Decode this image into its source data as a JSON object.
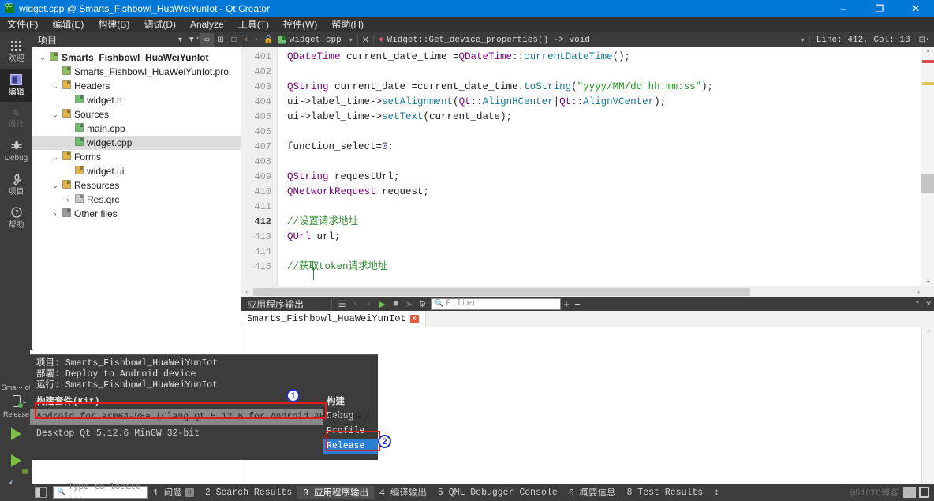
{
  "window": {
    "title": "widget.cpp @ Smarts_Fishbowl_HuaWeiYunIot - Qt Creator",
    "app_icon": "qt-creator-icon",
    "minimize": "–",
    "maximize": "❐",
    "close": "✕"
  },
  "menubar": {
    "items": [
      {
        "label": "文件(F)"
      },
      {
        "label": "编辑(E)"
      },
      {
        "label": "构建(B)"
      },
      {
        "label": "调试(D)"
      },
      {
        "label": "Analyze"
      },
      {
        "label": "工具(T)"
      },
      {
        "label": "控件(W)"
      },
      {
        "label": "帮助(H)"
      }
    ]
  },
  "modebar": {
    "modes": [
      {
        "label": "欢迎",
        "glyph": "∷",
        "state": "normal"
      },
      {
        "label": "编辑",
        "glyph": "▣",
        "state": "active"
      },
      {
        "label": "设计",
        "glyph": "✎",
        "state": "disabled"
      },
      {
        "label": "Debug",
        "glyph": "✶",
        "state": "normal"
      },
      {
        "label": "项目",
        "glyph": "⚒",
        "state": "normal"
      },
      {
        "label": "帮助",
        "glyph": "?",
        "state": "normal"
      }
    ],
    "kit_selector": {
      "project_short": "Sma⋯Iot",
      "build_config": "Release",
      "target_icon": "android-device-icon"
    },
    "run_button": "run-icon",
    "debug_button": "debug-icon",
    "build_button": "build-hammer-icon"
  },
  "project_panel": {
    "header": {
      "title": "项目",
      "dropdown_icon": "▾",
      "filter_icon": "filter-icon",
      "link_icon": "sync-with-editor-icon",
      "expand_icon": "expand-all-icon",
      "collapse_icon": "collapse-icon"
    },
    "tree": [
      {
        "indent": 0,
        "twisty": "⌄",
        "icon": "project-icon",
        "icon_color": "#8fbf5c",
        "label": "Smarts_Fishbowl_HuaWeiYunIot",
        "bold": true,
        "selected": false
      },
      {
        "indent": 1,
        "twisty": "",
        "icon": "pro-file-icon",
        "icon_color": "#8fbf5c",
        "label": "Smarts_Fishbowl_HuaWeiYunIot.pro",
        "bold": false,
        "selected": false
      },
      {
        "indent": 1,
        "twisty": "⌄",
        "icon": "headers-folder-icon",
        "icon_color": "#e0b24a",
        "label": "Headers",
        "bold": false,
        "selected": false
      },
      {
        "indent": 2,
        "twisty": "",
        "icon": "cpp-file-icon",
        "icon_color": "#6fbf6f",
        "label": "widget.h",
        "bold": false,
        "selected": false
      },
      {
        "indent": 1,
        "twisty": "⌄",
        "icon": "sources-folder-icon",
        "icon_color": "#e0b24a",
        "label": "Sources",
        "bold": false,
        "selected": false
      },
      {
        "indent": 2,
        "twisty": "",
        "icon": "cpp-file-icon",
        "icon_color": "#6fbf6f",
        "label": "main.cpp",
        "bold": false,
        "selected": false
      },
      {
        "indent": 2,
        "twisty": "",
        "icon": "cpp-file-icon",
        "icon_color": "#6fbf6f",
        "label": "widget.cpp",
        "bold": false,
        "selected": true
      },
      {
        "indent": 1,
        "twisty": "⌄",
        "icon": "forms-folder-icon",
        "icon_color": "#e0b24a",
        "label": "Forms",
        "bold": false,
        "selected": false
      },
      {
        "indent": 2,
        "twisty": "",
        "icon": "ui-file-icon",
        "icon_color": "#e0b24a",
        "label": "widget.ui",
        "bold": false,
        "selected": false
      },
      {
        "indent": 1,
        "twisty": "⌄",
        "icon": "resources-folder-icon",
        "icon_color": "#e0b24a",
        "label": "Resources",
        "bold": false,
        "selected": false
      },
      {
        "indent": 2,
        "twisty": "›",
        "icon": "qrc-file-icon",
        "icon_color": "#c8c8c8",
        "label": "Res.qrc",
        "bold": false,
        "selected": false
      },
      {
        "indent": 1,
        "twisty": "›",
        "icon": "other-files-icon",
        "icon_color": "#9a9a9a",
        "label": "Other files",
        "bold": false,
        "selected": false
      }
    ]
  },
  "editor": {
    "toolbar": {
      "back_icon": "‹",
      "forward_icon": "›",
      "lock_icon": "🔓",
      "file_name": "widget.cpp",
      "file_dropdown": "▾",
      "close_icon": "✕",
      "symbol_marker": "♦",
      "symbol_name": "Widget::Get_device_properties() -> void",
      "symbol_dropdown": "▾",
      "cursor_position": "Line: 412, Col: 13",
      "split_icon": "split-editor-icon"
    },
    "first_line_number": 401,
    "current_line": 412,
    "lines": [
      {
        "no": 401,
        "tokens": [
          {
            "t": "QDateTime",
            "c": "tk-type"
          },
          {
            "t": " current_date_time =",
            "c": "tk-plain"
          },
          {
            "t": "QDateTime",
            "c": "tk-type"
          },
          {
            "t": "::",
            "c": "tk-plain"
          },
          {
            "t": "currentDateTime",
            "c": "tk-fn"
          },
          {
            "t": "();",
            "c": "tk-plain"
          }
        ]
      },
      {
        "no": 402,
        "tokens": []
      },
      {
        "no": 403,
        "tokens": [
          {
            "t": "QString",
            "c": "tk-type"
          },
          {
            "t": " current_date =current_date_time.",
            "c": "tk-plain"
          },
          {
            "t": "toString",
            "c": "tk-fn"
          },
          {
            "t": "(",
            "c": "tk-plain"
          },
          {
            "t": "\"yyyy/MM/dd hh:mm:ss\"",
            "c": "tk-str"
          },
          {
            "t": ");",
            "c": "tk-plain"
          }
        ]
      },
      {
        "no": 404,
        "tokens": [
          {
            "t": "ui->label_time->",
            "c": "tk-plain"
          },
          {
            "t": "setAlignment",
            "c": "tk-fn"
          },
          {
            "t": "(",
            "c": "tk-plain"
          },
          {
            "t": "Qt",
            "c": "tk-type"
          },
          {
            "t": "::",
            "c": "tk-plain"
          },
          {
            "t": "AlignHCenter",
            "c": "tk-fn"
          },
          {
            "t": "|",
            "c": "tk-plain"
          },
          {
            "t": "Qt",
            "c": "tk-type"
          },
          {
            "t": "::",
            "c": "tk-plain"
          },
          {
            "t": "AlignVCenter",
            "c": "tk-fn"
          },
          {
            "t": ");",
            "c": "tk-plain"
          }
        ]
      },
      {
        "no": 405,
        "tokens": [
          {
            "t": "ui->label_time->",
            "c": "tk-plain"
          },
          {
            "t": "setText",
            "c": "tk-fn"
          },
          {
            "t": "(current_date);",
            "c": "tk-plain"
          }
        ]
      },
      {
        "no": 406,
        "tokens": []
      },
      {
        "no": 407,
        "tokens": [
          {
            "t": "function_select=",
            "c": "tk-plain"
          },
          {
            "t": "0",
            "c": "tk-num"
          },
          {
            "t": ";",
            "c": "tk-plain"
          }
        ]
      },
      {
        "no": 408,
        "tokens": []
      },
      {
        "no": 409,
        "tokens": [
          {
            "t": "QString",
            "c": "tk-type"
          },
          {
            "t": " requestUrl;",
            "c": "tk-plain"
          }
        ]
      },
      {
        "no": 410,
        "tokens": [
          {
            "t": "QNetworkRequest",
            "c": "tk-type"
          },
          {
            "t": " request;",
            "c": "tk-plain"
          }
        ]
      },
      {
        "no": 411,
        "tokens": []
      },
      {
        "no": 412,
        "tokens": [
          {
            "t": "//设置请求地址",
            "c": "tk-cmt"
          }
        ]
      },
      {
        "no": 413,
        "tokens": [
          {
            "t": "QUrl",
            "c": "tk-type"
          },
          {
            "t": " url;",
            "c": "tk-plain"
          }
        ]
      },
      {
        "no": 414,
        "tokens": []
      },
      {
        "no": 415,
        "tokens": [
          {
            "t": "//获取token请求地址",
            "c": "tk-cmt"
          }
        ]
      }
    ],
    "scroll_left_arrow": "‹",
    "scroll_right_arrow": "›",
    "marks_up": "⌃",
    "marks_down": "⌄"
  },
  "output_pane": {
    "title": "应用程序输出",
    "buttons": [
      {
        "name": "word-wrap-icon",
        "glyph": "☰",
        "state": "normal"
      },
      {
        "name": "prev-item-icon",
        "glyph": "‹",
        "state": "disabled"
      },
      {
        "name": "next-item-icon",
        "glyph": "›",
        "state": "disabled"
      },
      {
        "name": "run-icon",
        "glyph": "▶",
        "state": "play"
      },
      {
        "name": "stop-icon",
        "glyph": "■",
        "state": "stop"
      },
      {
        "name": "attach-icon",
        "glyph": "➤",
        "state": "disabled"
      },
      {
        "name": "settings-gear-icon",
        "glyph": "⚙",
        "state": "normal"
      }
    ],
    "filter_placeholder": "Filter",
    "zoom_in": "+",
    "zoom_out": "−",
    "maximize_icon": "⌃",
    "close_icon": "✕",
    "tabs": [
      {
        "label": "Smarts_Fishbowl_HuaWeiYunIot",
        "close": "✕"
      }
    ],
    "scroll_up": "⌃",
    "scroll_down": "⌄"
  },
  "kit_popup": {
    "meta": [
      {
        "key": "项目:",
        "value": "Smarts_Fishbowl_HuaWeiYunIot"
      },
      {
        "key": "部署:",
        "value": "Deploy to Android device"
      },
      {
        "key": "运行:",
        "value": "Smarts_Fishbowl_HuaWeiYunIot"
      }
    ],
    "kit_column_header": "构建套件(Kit)",
    "build_column_header": "构建",
    "kits": [
      {
        "label": "Android for arm64-v8a (Clang Qt 5.12.6 for Android ARM64-v8a)",
        "selected": true
      },
      {
        "label": "Desktop Qt 5.12.6 MinGW 32-bit",
        "selected": false
      }
    ],
    "builds": [
      {
        "label": "Debug",
        "selected": false
      },
      {
        "label": "Profile",
        "selected": false
      },
      {
        "label": "Release",
        "selected": true
      }
    ],
    "annotations": [
      {
        "number": "1",
        "target": "kit-row-android"
      },
      {
        "number": "2",
        "target": "build-row-release"
      }
    ]
  },
  "statusbar": {
    "sidebar_toggle": "sidebar-toggle-icon",
    "locator_placeholder": "Type to locate ...",
    "items": [
      {
        "label": "1 问题",
        "badge": "8",
        "active": false
      },
      {
        "label": "2 Search Results",
        "badge": "",
        "active": false
      },
      {
        "label": "3 应用程序输出",
        "badge": "",
        "active": true
      },
      {
        "label": "4 编译输出",
        "badge": "",
        "active": false
      },
      {
        "label": "5 QML Debugger Console",
        "badge": "",
        "active": false
      },
      {
        "label": "6 概要信息",
        "badge": "",
        "active": false
      },
      {
        "label": "8 Test Results",
        "badge": "",
        "active": false
      },
      {
        "label": "↕",
        "badge": "",
        "active": false
      }
    ],
    "watermark": "@51CTO博客"
  }
}
